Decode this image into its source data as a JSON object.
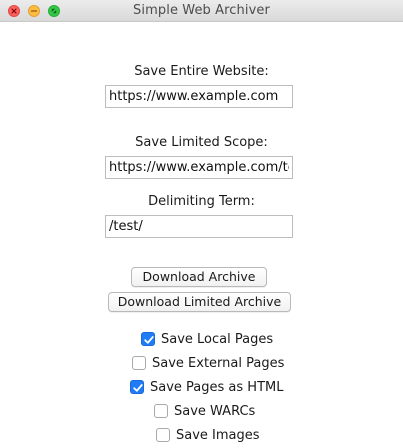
{
  "window": {
    "title": "Simple Web Archiver"
  },
  "form": {
    "entire_label": "Save Entire Website:",
    "entire_value": "https://www.example.com",
    "limited_label": "Save Limited Scope:",
    "limited_value": "https://www.example.com/test",
    "delimiting_label": "Delimiting Term:",
    "delimiting_value": "/test/"
  },
  "buttons": {
    "download_archive": "Download Archive",
    "download_limited_archive": "Download Limited Archive"
  },
  "options": [
    {
      "label": "Save Local Pages",
      "checked": true
    },
    {
      "label": "Save External Pages",
      "checked": false
    },
    {
      "label": "Save Pages as HTML",
      "checked": true
    },
    {
      "label": "Save WARCs",
      "checked": false
    },
    {
      "label": "Save Images",
      "checked": false
    }
  ],
  "colors": {
    "accent": "#1f7cf6",
    "close": "#fc605c",
    "minimize": "#fdbc40",
    "maximize": "#34c84a"
  }
}
